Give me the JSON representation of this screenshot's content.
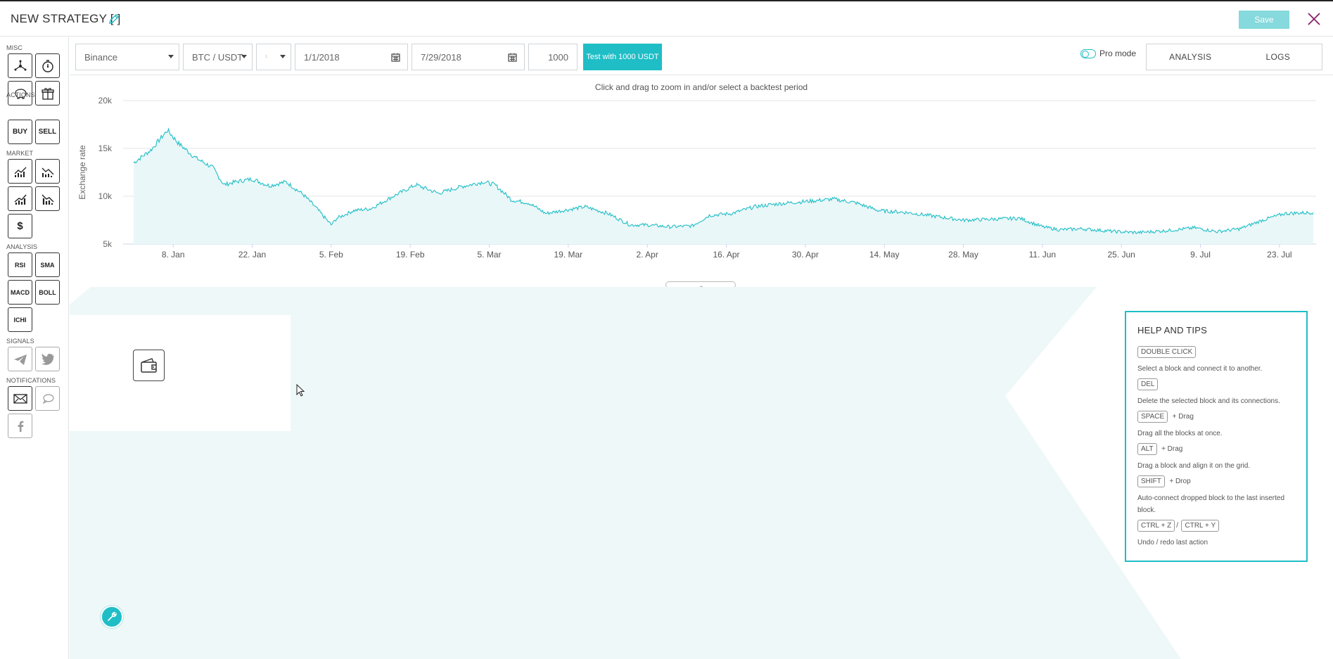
{
  "header": {
    "title": "NEW STRATEGY [ ]",
    "save_label": "Save"
  },
  "sidebar": {
    "sections": {
      "misc": "MISC",
      "actions": "ACTIONS",
      "market": "MARKET",
      "analysis": "ANALYSIS",
      "signals": "SIGNALS",
      "notifications": "NOTIFICATIONS"
    },
    "actions": {
      "buy": "BUY",
      "sell": "SELL"
    },
    "market": {
      "dollar": "$"
    },
    "analysis": {
      "rsi": "RSI",
      "sma": "SMA",
      "macd": "MACD",
      "boll": "BOLL",
      "ichi": "ICHI"
    }
  },
  "toolbar": {
    "exchange": "Binance",
    "pair": "BTC / USDT",
    "interval": "1",
    "start_date": "1/1/2018",
    "end_date": "7/29/2018",
    "amount": "1000",
    "test_label": "Test with 1000 USDT",
    "pro_mode_label": "Pro mode",
    "tabs": [
      "ANALYSIS",
      "LOGS"
    ]
  },
  "chart_hint": "Click and drag to zoom in and/or select a backtest period",
  "chart_data": {
    "type": "area",
    "title": "",
    "xlabel": "",
    "ylabel": "Exchange rate",
    "x_ticks": [
      "8. Jan",
      "22. Jan",
      "5. Feb",
      "19. Feb",
      "5. Mar",
      "19. Mar",
      "2. Apr",
      "16. Apr",
      "30. Apr",
      "14. May",
      "28. May",
      "11. Jun",
      "25. Jun",
      "9. Jul",
      "23. Jul"
    ],
    "y_ticks": [
      "5k",
      "10k",
      "15k",
      "20k"
    ],
    "ylim": [
      5000,
      20000
    ],
    "xlim": [
      "2018-01-01",
      "2018-07-29"
    ],
    "grid": true,
    "color": "#1fbec6",
    "series": [
      {
        "x": [
          "2018-01-01",
          "2018-01-04",
          "2018-01-07",
          "2018-01-09",
          "2018-01-12",
          "2018-01-15",
          "2018-01-17",
          "2018-01-19",
          "2018-01-22",
          "2018-01-25",
          "2018-01-28",
          "2018-01-31",
          "2018-02-02",
          "2018-02-05",
          "2018-02-06",
          "2018-02-09",
          "2018-02-12",
          "2018-02-16",
          "2018-02-20",
          "2018-02-24",
          "2018-02-28",
          "2018-03-04",
          "2018-03-06",
          "2018-03-09",
          "2018-03-12",
          "2018-03-15",
          "2018-03-18",
          "2018-03-22",
          "2018-03-26",
          "2018-03-30",
          "2018-04-02",
          "2018-04-06",
          "2018-04-10",
          "2018-04-13",
          "2018-04-17",
          "2018-04-21",
          "2018-04-25",
          "2018-04-29",
          "2018-05-05",
          "2018-05-09",
          "2018-05-13",
          "2018-05-18",
          "2018-05-23",
          "2018-05-28",
          "2018-06-02",
          "2018-06-07",
          "2018-06-11",
          "2018-06-14",
          "2018-06-18",
          "2018-06-24",
          "2018-06-28",
          "2018-07-03",
          "2018-07-08",
          "2018-07-12",
          "2018-07-16",
          "2018-07-20",
          "2018-07-24",
          "2018-07-29"
        ],
        "y": [
          13500,
          14800,
          16900,
          15500,
          14000,
          13000,
          11200,
          11500,
          11800,
          11100,
          11500,
          10200,
          9000,
          7000,
          7700,
          8500,
          8700,
          10000,
          11200,
          10300,
          11000,
          11500,
          11200,
          9600,
          9300,
          8200,
          8500,
          8900,
          8200,
          7000,
          7000,
          6800,
          6900,
          8000,
          8200,
          8900,
          9200,
          9400,
          9700,
          9300,
          8500,
          8300,
          7900,
          7500,
          7600,
          7700,
          6800,
          6500,
          6600,
          6300,
          6200,
          6400,
          6700,
          6300,
          6600,
          7500,
          8200,
          8300
        ]
      }
    ]
  },
  "help": {
    "title": "HELP AND TIPS",
    "tips": [
      {
        "keys": [
          "DOUBLE CLICK"
        ],
        "suffix": "",
        "desc": "Select a block and connect it to another."
      },
      {
        "keys": [
          "DEL"
        ],
        "suffix": "",
        "desc": "Delete the selected block and its connections."
      },
      {
        "keys": [
          "SPACE"
        ],
        "suffix": "+ Drag",
        "desc": "Drag all the blocks at once."
      },
      {
        "keys": [
          "ALT"
        ],
        "suffix": "+ Drag",
        "desc": "Drag a block and align it on the grid."
      },
      {
        "keys": [
          "SHIFT"
        ],
        "suffix": "+ Drop",
        "desc": "Auto-connect dropped block to the last inserted block."
      },
      {
        "keys": [
          "CTRL + Z",
          "CTRL + Y"
        ],
        "sep": "/",
        "suffix": "",
        "desc": "Undo / redo last action"
      }
    ]
  },
  "icons": {
    "edit": "pencil-icon",
    "close": "close-icon",
    "calendar": "calendar-icon",
    "wrench": "wrench-icon",
    "wallet": "wallet-icon"
  }
}
